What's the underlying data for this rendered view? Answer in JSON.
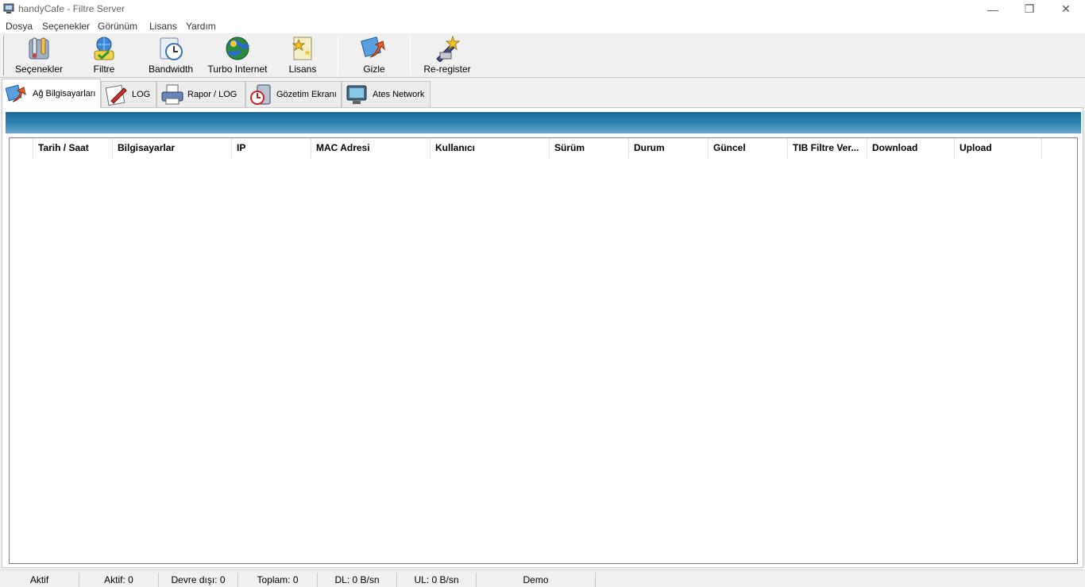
{
  "window": {
    "title": "handyCafe - Filtre Server",
    "icon": "computer-icon",
    "controls": {
      "minimize": "—",
      "restore": "❐",
      "close": "✕"
    }
  },
  "menu": [
    "Dosya",
    "Seçenekler",
    "Görünüm",
    "Lisans",
    "Yardım"
  ],
  "toolbar": [
    {
      "label": "Seçenekler",
      "icon": "tools-icon"
    },
    {
      "label": "Filtre",
      "icon": "filter-globe-icon"
    },
    {
      "label": "Bandwidth",
      "icon": "bandwidth-clock-icon"
    },
    {
      "label": "Turbo Internet",
      "icon": "globe-icon"
    },
    {
      "label": "Lisans",
      "icon": "license-stars-icon"
    },
    {
      "label": "Gizle",
      "icon": "hide-arrow-icon"
    },
    {
      "label": "Re-register",
      "icon": "register-wand-icon"
    }
  ],
  "tabs": [
    {
      "label": "Ağ Bilgisayarları",
      "icon": "network-arrow-icon",
      "active": true
    },
    {
      "label": "LOG",
      "icon": "log-pen-icon",
      "active": false
    },
    {
      "label": "Rapor / LOG",
      "icon": "printer-icon",
      "active": false
    },
    {
      "label": "Gözetim Ekranı",
      "icon": "monitor-icon",
      "active": false
    },
    {
      "label": "Ates Network",
      "icon": "network-monitor-icon",
      "active": false
    }
  ],
  "table": {
    "columns": [
      "Tarih / Saat",
      "Bilgisayarlar",
      "IP",
      "MAC Adresi",
      "Kullanıcı",
      "Sürüm",
      "Durum",
      "Güncel",
      "TIB Filtre Ver...",
      "Download",
      "Upload"
    ],
    "rows": []
  },
  "status": [
    "Aktif",
    "Aktif: 0",
    "Devre dışı: 0",
    "Toplam: 0",
    "DL: 0 B/sn",
    "UL: 0 B/sn",
    "Demo"
  ],
  "colors": {
    "panel_header_top": "#1e6a9a",
    "panel_header_bottom": "#6aa6c8"
  }
}
